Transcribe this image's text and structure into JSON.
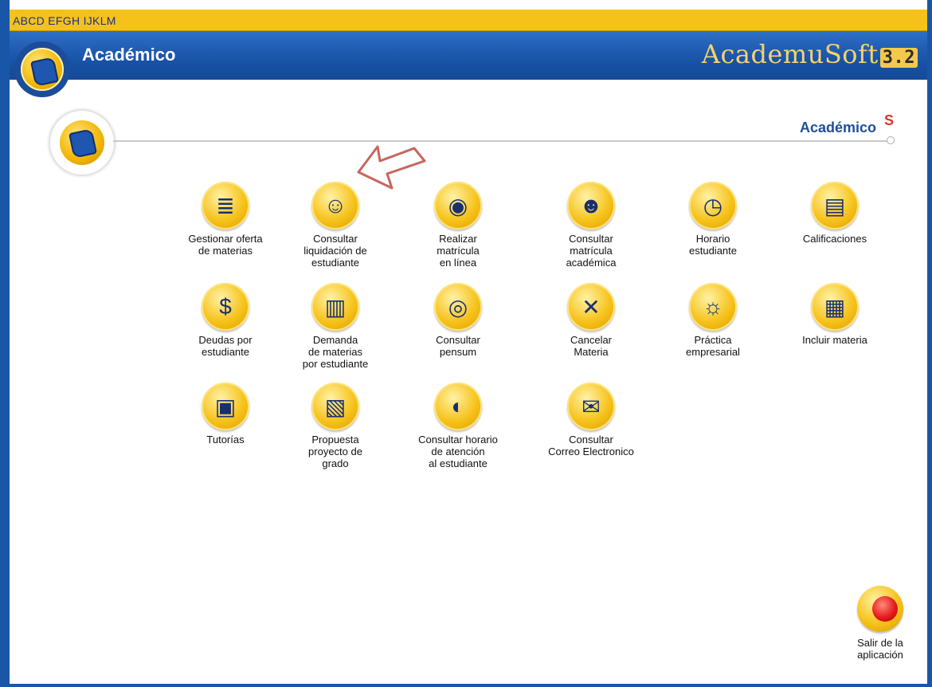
{
  "window": {
    "title": "ABCD EFGH IJKLM"
  },
  "header": {
    "title": "Académico",
    "brand_name": "AcademuSoft",
    "brand_version": "3.2"
  },
  "section": {
    "title": "Académico"
  },
  "menu": [
    {
      "label": "Gestionar oferta\nde materias",
      "icon": "stack-books-icon"
    },
    {
      "label": "Consultar\nliquidación de\nestudiante",
      "icon": "invoice-money-icon"
    },
    {
      "label": "Realizar\nmatrícula\nen línea",
      "icon": "online-globe-icon"
    },
    {
      "label": "Consultar\nmatrícula\nacadémica",
      "icon": "students-group-icon"
    },
    {
      "label": "Horario\nestudiante",
      "icon": "clock-schedule-icon"
    },
    {
      "label": "Calificaciones",
      "icon": "grades-sheet-icon"
    },
    {
      "label": "Deudas por\nestudiante",
      "icon": "debt-dollar-icon"
    },
    {
      "label": "Demanda\nde materias\npor estudiante",
      "icon": "demand-chart-icon"
    },
    {
      "label": "Consultar\npensum",
      "icon": "pensum-eye-icon"
    },
    {
      "label": "Cancelar\nMateria",
      "icon": "cancel-x-icon"
    },
    {
      "label": "Práctica\nempresarial",
      "icon": "business-person-icon"
    },
    {
      "label": "Incluir materia",
      "icon": "add-subject-icon"
    },
    {
      "label": "Tutorías",
      "icon": "tutor-screen-icon"
    },
    {
      "label": "Propuesta\nproyecto de\ngrado",
      "icon": "proposal-document-icon"
    },
    {
      "label": "Consultar horario\nde atención\nal estudiante",
      "icon": "attention-schedule-icon"
    },
    {
      "label": "Consultar\nCorreo Electronico",
      "icon": "gmail-icon"
    }
  ],
  "exit": {
    "label": "Salir de la\naplicación",
    "icon": "exit-red-button-icon"
  },
  "colors": {
    "frame_blue": "#1a56a8",
    "top_yellow": "#f6c21a",
    "brand_gold": "#f6d36a"
  }
}
